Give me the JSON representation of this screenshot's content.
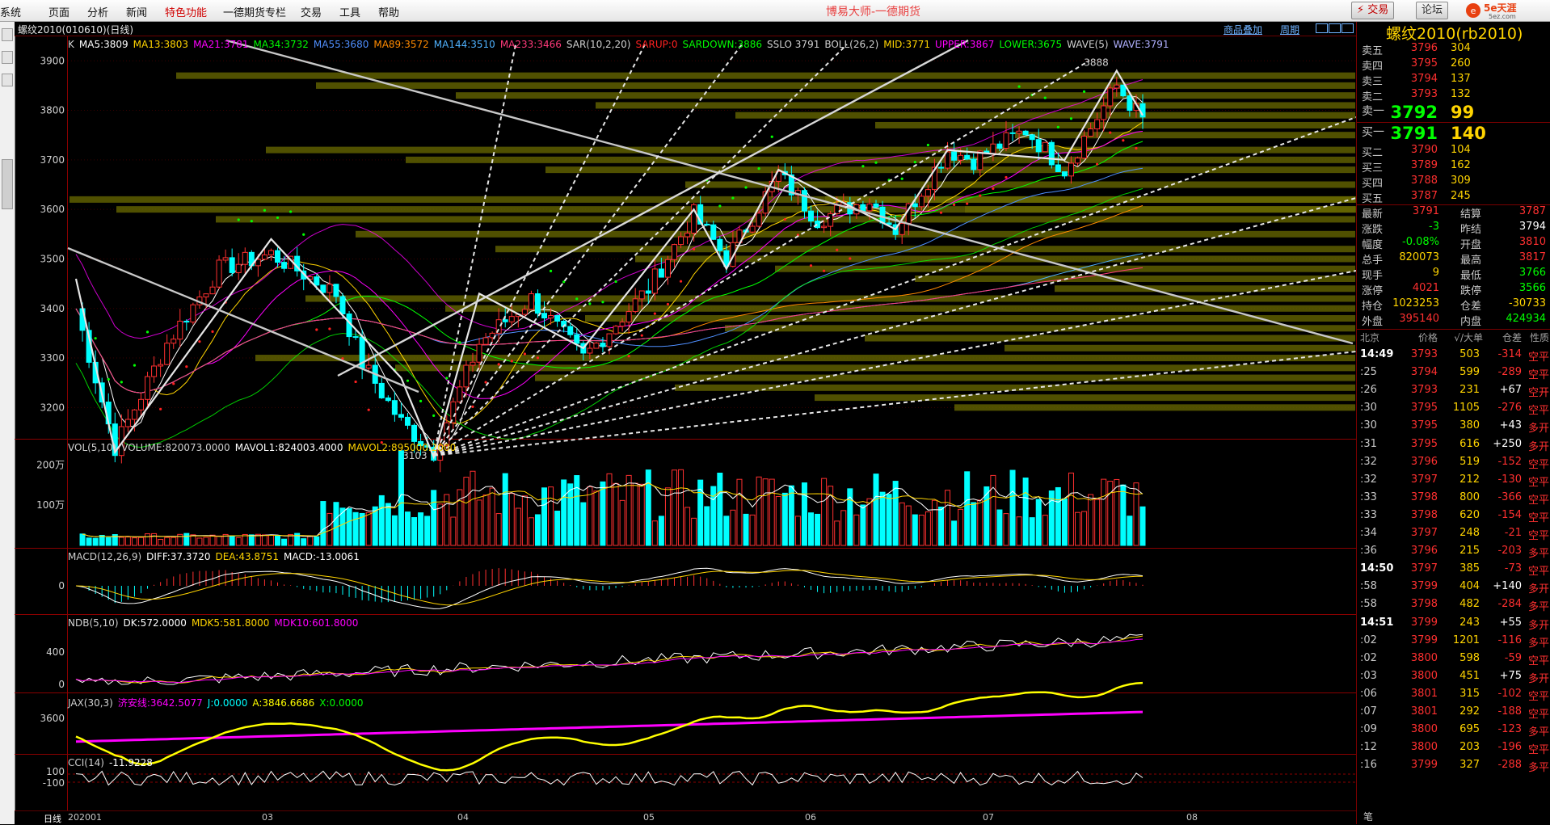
{
  "menubar": {
    "items": [
      "系统",
      "页面",
      "分析",
      "新闻",
      "特色功能",
      "一德期货专栏",
      "交易",
      "工具",
      "帮助"
    ],
    "highlighted": "特色功能",
    "title": "博易大师-一德期货",
    "trade_button": "⚡ 交易",
    "forum_button": "论坛",
    "logo_text": "5e天涯",
    "logo_sub": "5ez.com"
  },
  "chart": {
    "title": "螺纹2010(010610)(日线)",
    "link_overlay": "商品叠加",
    "link_period": "周期",
    "main_legend": [
      {
        "text": "K",
        "color": "#d0d0d0"
      },
      {
        "text": "MA5:3809",
        "color": "#ffffff"
      },
      {
        "text": "MA13:3803",
        "color": "#ffd400"
      },
      {
        "text": "MA21:3781",
        "color": "#ff00ff"
      },
      {
        "text": "MA34:3732",
        "color": "#00ff00"
      },
      {
        "text": "MA55:3680",
        "color": "#4f8fff"
      },
      {
        "text": "MA89:3572",
        "color": "#ff8a00"
      },
      {
        "text": "MA144:3510",
        "color": "#4fb2ff"
      },
      {
        "text": "MA233:3466",
        "color": "#ff3a7a"
      },
      {
        "text": "SAR(10,2,20)",
        "color": "#d0d0d0"
      },
      {
        "text": "SARUP:0",
        "color": "#ff2020"
      },
      {
        "text": "SARDOWN:3886",
        "color": "#00ff00"
      },
      {
        "text": "SSLO 3791",
        "color": "#d0d0d0"
      },
      {
        "text": "BOLL(26,2)",
        "color": "#d0d0d0"
      },
      {
        "text": "MID:3771",
        "color": "#ffd400"
      },
      {
        "text": "UPPER:3867",
        "color": "#ff00ff"
      },
      {
        "text": "LOWER:3675",
        "color": "#00ff00"
      },
      {
        "text": "WAVE(5)",
        "color": "#d0d0d0"
      },
      {
        "text": "WAVE:3791",
        "color": "#b0b0ff"
      }
    ],
    "price_ticks": [
      "3900",
      "3800",
      "3700",
      "3600",
      "3500",
      "3400",
      "3300",
      "3200"
    ],
    "price_low_label": "3103",
    "price_high_label": "3888",
    "vol_legend": [
      {
        "text": "VOL(5,10)",
        "color": "#d0d0d0"
      },
      {
        "text": "VOLUME:820073.0000",
        "color": "#d0d0d0"
      },
      {
        "text": "MAVOL1:824003.4000",
        "color": "#ffffff"
      },
      {
        "text": "MAVOL2:895000.2000",
        "color": "#ffd400"
      }
    ],
    "vol_ticks": [
      "200万",
      "100万"
    ],
    "macd_legend": [
      {
        "text": "MACD(12,26,9)",
        "color": "#d0d0d0"
      },
      {
        "text": "DIFF:37.3720",
        "color": "#ffffff"
      },
      {
        "text": "DEA:43.8751",
        "color": "#ffd400"
      },
      {
        "text": "MACD:-13.0061",
        "color": "#ffffff"
      }
    ],
    "macd_ticks": [
      "0"
    ],
    "ndb_legend": [
      {
        "text": "NDB(5,10)",
        "color": "#d0d0d0"
      },
      {
        "text": "DK:572.0000",
        "color": "#ffffff"
      },
      {
        "text": "MDK5:581.8000",
        "color": "#ffd400"
      },
      {
        "text": "MDK10:601.8000",
        "color": "#ff00ff"
      }
    ],
    "ndb_ticks": [
      "400",
      "0"
    ],
    "jax_legend": [
      {
        "text": "JAX(30,3)",
        "color": "#d0d0d0"
      },
      {
        "text": "济安线:3642.5077",
        "color": "#ff00ff"
      },
      {
        "text": "J:0.0000",
        "color": "#00ffff"
      },
      {
        "text": "A:3846.6686",
        "color": "#ffff00"
      },
      {
        "text": "X:0.0000",
        "color": "#00ff00"
      }
    ],
    "jax_ticks": [
      "3600"
    ],
    "cci_legend": [
      {
        "text": "CCI(14)",
        "color": "#d0d0d0"
      },
      {
        "text": "-11.9228",
        "color": "#ffffff"
      }
    ],
    "cci_ticks": [
      "100",
      "-100"
    ],
    "x_axis": {
      "period_label": "日线",
      "dates": [
        "202001",
        "03",
        "04",
        "05",
        "06",
        "07",
        "08"
      ]
    }
  },
  "chart_data": {
    "type": "candlestick",
    "title": "螺纹2010(010610)(日线)",
    "ylim": [
      3103,
      3888
    ],
    "price_scale": [
      3150,
      3920
    ],
    "annotated_low": 3103,
    "annotated_high": 3888,
    "last_close": 3791,
    "ma_lines": {
      "MA5": 3809,
      "MA13": 3803,
      "MA21": 3781,
      "MA34": 3732,
      "MA55": 3680,
      "MA89": 3572,
      "MA144": 3510,
      "MA233": 3466
    },
    "boll": {
      "mid": 3771,
      "upper": 3867,
      "lower": 3675
    },
    "volume_last": 820073,
    "mavol1": 824003.4,
    "mavol2": 895000.2,
    "macd": {
      "diff": 37.372,
      "dea": 43.8751,
      "macd": -13.0061
    },
    "ndb": {
      "dk": 572,
      "mdk5": 581.8,
      "mdk10": 601.8
    },
    "jax": {
      "jian_line": 3642.5077,
      "j": 0,
      "a": 3846.6686,
      "x": 0
    },
    "cci": -11.9228
  },
  "quote": {
    "title": "螺纹2010(rb2010)",
    "asks": [
      {
        "label": "卖五",
        "price": "3796",
        "vol": "304"
      },
      {
        "label": "卖四",
        "price": "3795",
        "vol": "260"
      },
      {
        "label": "卖三",
        "price": "3794",
        "vol": "137"
      },
      {
        "label": "卖二",
        "price": "3793",
        "vol": "132"
      },
      {
        "label": "卖一",
        "price": "3792",
        "vol": "99"
      }
    ],
    "bids": [
      {
        "label": "买一",
        "price": "3791",
        "vol": "140"
      },
      {
        "label": "买二",
        "price": "3790",
        "vol": "104"
      },
      {
        "label": "买三",
        "price": "3789",
        "vol": "162"
      },
      {
        "label": "买四",
        "price": "3788",
        "vol": "309"
      },
      {
        "label": "买五",
        "price": "3787",
        "vol": "245"
      }
    ],
    "stats": [
      {
        "k1": "最新",
        "v1": "3791",
        "c1": "#ff3030",
        "k2": "结算",
        "v2": "3787",
        "c2": "#ff3030"
      },
      {
        "k1": "涨跌",
        "v1": "-3",
        "c1": "#00ff00",
        "k2": "昨结",
        "v2": "3794",
        "c2": "#ffffff"
      },
      {
        "k1": "幅度",
        "v1": "-0.08%",
        "c1": "#00ff00",
        "k2": "开盘",
        "v2": "3810",
        "c2": "#ff3030"
      },
      {
        "k1": "总手",
        "v1": "820073",
        "c1": "#ffd400",
        "k2": "最高",
        "v2": "3817",
        "c2": "#ff3030"
      },
      {
        "k1": "现手",
        "v1": "9",
        "c1": "#ffd400",
        "k2": "最低",
        "v2": "3766",
        "c2": "#00ff00"
      },
      {
        "k1": "涨停",
        "v1": "4021",
        "c1": "#ff3030",
        "k2": "跌停",
        "v2": "3566",
        "c2": "#00ff00"
      },
      {
        "k1": "持仓",
        "v1": "1023253",
        "c1": "#ffd400",
        "k2": "仓差",
        "v2": "-30733",
        "c2": "#ffd400"
      },
      {
        "k1": "外盘",
        "v1": "395140",
        "c1": "#ff3030",
        "k2": "内盘",
        "v2": "424934",
        "c2": "#00ff00"
      }
    ],
    "ticks_header": {
      "tz": "北京",
      "price": "价格",
      "vol": "√/大单",
      "chg": "仓差",
      "nature": "性质"
    },
    "ticks": [
      {
        "t": "14:49",
        "full": true,
        "p": "3793",
        "v": "503",
        "c": "-314",
        "n": "空平"
      },
      {
        "t": ":25",
        "full": false,
        "p": "3794",
        "v": "599",
        "c": "-289",
        "n": "空平"
      },
      {
        "t": ":26",
        "full": false,
        "p": "3793",
        "v": "231",
        "c": "+67",
        "n": "空开"
      },
      {
        "t": ":30",
        "full": false,
        "p": "3795",
        "v": "1105",
        "c": "-276",
        "n": "空平"
      },
      {
        "t": ":30",
        "full": false,
        "p": "3795",
        "v": "380",
        "c": "+43",
        "n": "多开"
      },
      {
        "t": ":31",
        "full": false,
        "p": "3795",
        "v": "616",
        "c": "+250",
        "n": "多开"
      },
      {
        "t": ":32",
        "full": false,
        "p": "3796",
        "v": "519",
        "c": "-152",
        "n": "空平"
      },
      {
        "t": ":32",
        "full": false,
        "p": "3797",
        "v": "212",
        "c": "-130",
        "n": "空平"
      },
      {
        "t": ":33",
        "full": false,
        "p": "3798",
        "v": "800",
        "c": "-366",
        "n": "空平"
      },
      {
        "t": ":33",
        "full": false,
        "p": "3798",
        "v": "620",
        "c": "-154",
        "n": "空平"
      },
      {
        "t": ":34",
        "full": false,
        "p": "3797",
        "v": "248",
        "c": "-21",
        "n": "空平"
      },
      {
        "t": ":36",
        "full": false,
        "p": "3796",
        "v": "215",
        "c": "-203",
        "n": "多平"
      },
      {
        "t": "14:50",
        "full": true,
        "p": "3797",
        "v": "385",
        "c": "-73",
        "n": "空平"
      },
      {
        "t": ":58",
        "full": false,
        "p": "3799",
        "v": "404",
        "c": "+140",
        "n": "多开"
      },
      {
        "t": ":58",
        "full": false,
        "p": "3798",
        "v": "482",
        "c": "-284",
        "n": "多平"
      },
      {
        "t": "14:51",
        "full": true,
        "p": "3799",
        "v": "243",
        "c": "+55",
        "n": "多开"
      },
      {
        "t": ":02",
        "full": false,
        "p": "3799",
        "v": "1201",
        "c": "-116",
        "n": "多平"
      },
      {
        "t": ":02",
        "full": false,
        "p": "3800",
        "v": "598",
        "c": "-59",
        "n": "空平"
      },
      {
        "t": ":03",
        "full": false,
        "p": "3800",
        "v": "451",
        "c": "+75",
        "n": "多开"
      },
      {
        "t": ":06",
        "full": false,
        "p": "3801",
        "v": "315",
        "c": "-102",
        "n": "空平"
      },
      {
        "t": ":07",
        "full": false,
        "p": "3801",
        "v": "292",
        "c": "-188",
        "n": "空平"
      },
      {
        "t": ":09",
        "full": false,
        "p": "3800",
        "v": "695",
        "c": "-123",
        "n": "多平"
      },
      {
        "t": ":12",
        "full": false,
        "p": "3800",
        "v": "203",
        "c": "-196",
        "n": "空平"
      },
      {
        "t": ":16",
        "full": false,
        "p": "3799",
        "v": "327",
        "c": "-288",
        "n": "多平"
      }
    ],
    "footer": "笔"
  }
}
